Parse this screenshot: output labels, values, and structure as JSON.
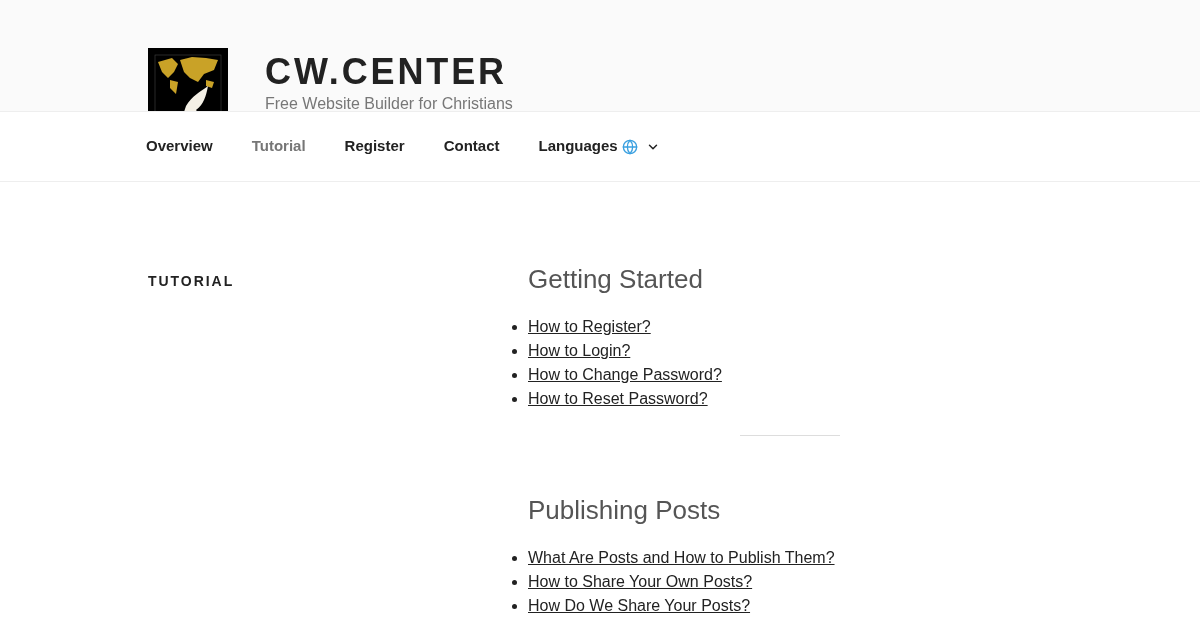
{
  "site": {
    "title": "CW.CENTER",
    "tagline": "Free Website Builder for Christians"
  },
  "nav": [
    {
      "label": "Overview",
      "selected": false,
      "dropdown": false
    },
    {
      "label": "Tutorial",
      "selected": true,
      "dropdown": false
    },
    {
      "label": "Register",
      "selected": false,
      "dropdown": false
    },
    {
      "label": "Contact",
      "selected": false,
      "dropdown": false
    },
    {
      "label": "Languages",
      "selected": false,
      "dropdown": true
    }
  ],
  "page_title": "TUTORIAL",
  "sections": [
    {
      "heading": "Getting Started",
      "links": [
        "How to Register?",
        "How to Login?",
        "How to Change Password?",
        "How to Reset Password?"
      ]
    },
    {
      "heading": "Publishing Posts",
      "links": [
        "What Are Posts and How to Publish Them?",
        "How to Share Your Own Posts?",
        "How Do We Share Your Posts?"
      ]
    }
  ]
}
